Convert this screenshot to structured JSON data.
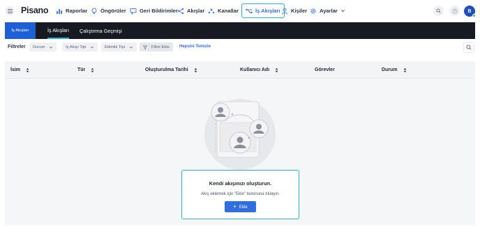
{
  "app": {
    "logo": "Pisano",
    "avatar_initial": "B"
  },
  "nav": {
    "items": [
      {
        "label": "Raporlar",
        "icon": "bar-chart-icon"
      },
      {
        "label": "Öngörüler",
        "icon": "bulb-icon"
      },
      {
        "label": "Geri Bildirimler",
        "icon": "chat-icon"
      },
      {
        "label": "Akışlar",
        "icon": "flow-icon"
      },
      {
        "label": "Kanallar",
        "icon": "channels-icon"
      },
      {
        "label": "İş Akışları",
        "icon": "workflow-icon",
        "active": true
      },
      {
        "label": "Kişiler",
        "icon": "person-icon"
      },
      {
        "label": "Ayarlar",
        "icon": "gear-icon"
      }
    ]
  },
  "subheader": {
    "badge": "İş Akışları",
    "tabs": [
      {
        "label": "İş Akışları",
        "active": true
      },
      {
        "label": "Çalıştırma Geçmişi",
        "active": false
      }
    ]
  },
  "filters": {
    "label": "Filtreler",
    "chips": [
      "Durum",
      "İş Akışı Tipi",
      "Etkinlik Tipi"
    ],
    "add_filter": "Filtre Ekle",
    "clear_all": "Hepsini Temizle"
  },
  "table": {
    "columns": [
      "İsim",
      "Tür",
      "Oluşturulma Tarihi",
      "Kullanıcı Adı",
      "Görevler",
      "Durum"
    ]
  },
  "empty_state": {
    "title": "Kendi akışınızı oluşturun.",
    "description": "Akış eklemek için \"Ekle\" butonuna tıklayın.",
    "button": "Ekle"
  },
  "colors": {
    "accent": "#2f6fe0",
    "highlight": "#2bb3d6",
    "dark_bar": "#171a22",
    "badge": "#1f5fd6"
  }
}
